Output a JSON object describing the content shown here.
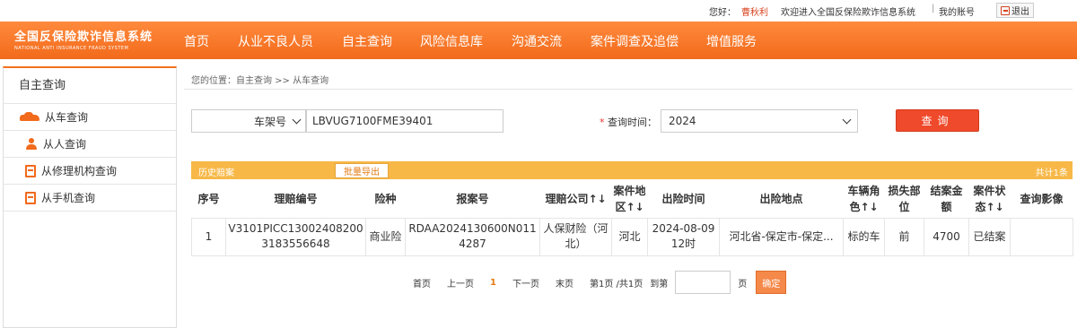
{
  "topbar": {
    "greeting": "您好：",
    "username": "曹秋利",
    "welcome": "欢迎进入全国反保险欺诈信息系统",
    "separator": "|",
    "my_account": "我的账号",
    "logout": "退出"
  },
  "logo": {
    "cn": "全国反保险欺诈信息系统",
    "en": "NATIONAL ANTI INSURANCE FRAUD SYSTEM"
  },
  "nav": [
    "首页",
    "从业不良人员",
    "自主查询",
    "风险信息库",
    "沟通交流",
    "案件调查及追偿",
    "增值服务"
  ],
  "sidebar": {
    "title": "自主查询",
    "items": [
      "从车查询",
      "从人查询",
      "从修理机构查询",
      "从手机查询"
    ]
  },
  "breadcrumb": "您的位置：自主查询 >> 从车查询",
  "search": {
    "field_type": "车架号",
    "vin_value": "LBVUG7100FME39401",
    "time_label_star": "*",
    "time_label": "查询时间：",
    "time_value": "2024",
    "query_button": "查询"
  },
  "history": {
    "title": "历史赔案",
    "export_button": "批量导出",
    "total": "共计1条"
  },
  "table": {
    "headers": [
      "序号",
      "理赔编号",
      "险种",
      "报案号",
      "理赔公司↑↓",
      "案件地区↑↓",
      "出险时间",
      "出险地点",
      "车辆角色↑↓",
      "损失部位",
      "结案金额",
      "案件状态↑↓",
      "查询影像"
    ],
    "rows": [
      [
        "1",
        "V3101PICC130024082003183556648",
        "商业险",
        "RDAA2024130600N0114287",
        "人保财险（河北）",
        "河北",
        "2024-08-09 12时",
        "河北省-保定市-保定...",
        "标的车",
        "前",
        "4700",
        "已结案",
        ""
      ]
    ]
  },
  "pager": {
    "first": "首页",
    "prev": "上一页",
    "current": "1",
    "next": "下一页",
    "last": "末页",
    "info": "第1页 /共1页",
    "goto": "到第",
    "unit": "页",
    "confirm": "确定"
  }
}
